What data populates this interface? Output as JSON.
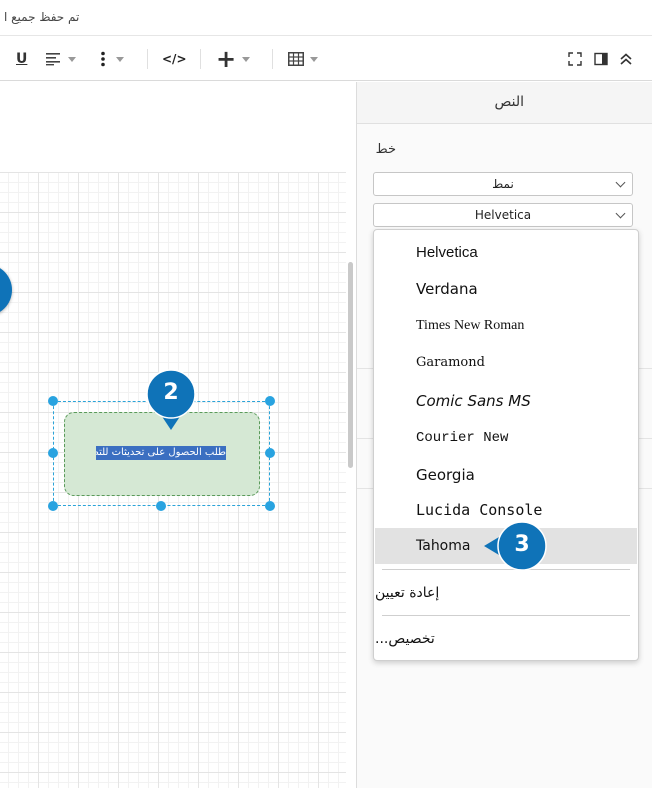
{
  "status": {
    "text": "تم حفظ جميع ا"
  },
  "toolbar": {
    "underline": "U",
    "code": "</>",
    "insert": "+"
  },
  "canvas": {
    "shape_label": "طلب الحصول على تحديثات للتطبيق"
  },
  "markers": {
    "m2": "2",
    "m3": "3"
  },
  "panel": {
    "tab_label": "النص",
    "font_label": "خط",
    "style_select": "نمط",
    "font_select": "Helvetica"
  },
  "dropdown": {
    "fonts": [
      "Helvetica",
      "Verdana",
      "Times New Roman",
      "Garamond",
      "Comic Sans MS",
      "Courier New",
      "Georgia",
      "Lucida Console",
      "Tahoma"
    ],
    "reset": "إعادة تعيين",
    "custom": "تخصيص..."
  },
  "colors": {
    "accent": "#0f73b8",
    "shape_fill": "#d5e8d4",
    "handle": "#29a3e0",
    "selection": "#3b6fc1"
  }
}
